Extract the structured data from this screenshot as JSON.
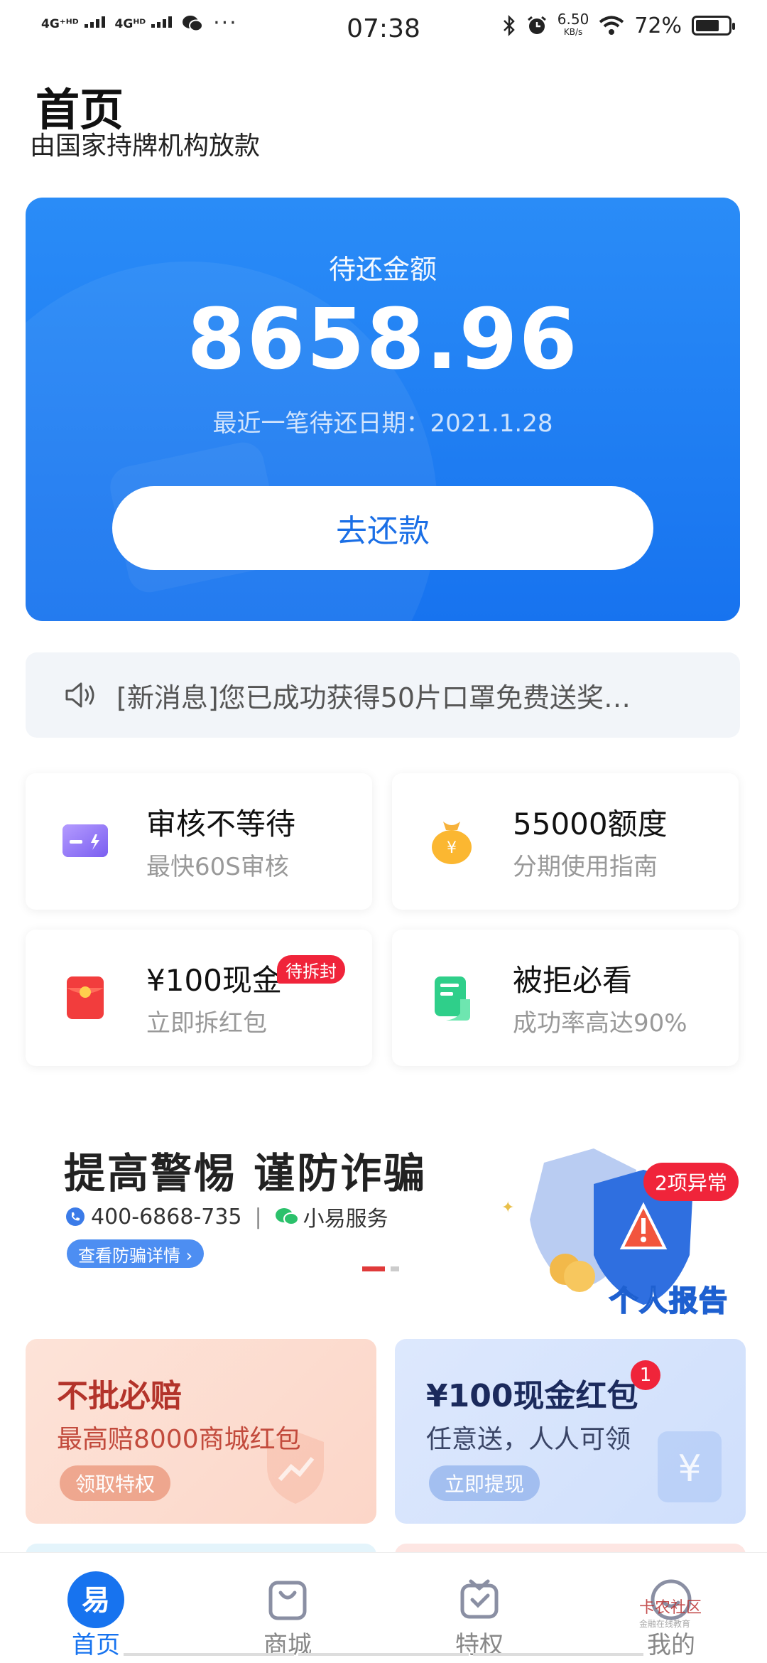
{
  "status_bar": {
    "net1": "4G⁺ᴴᴰ",
    "net2": "4Gᴴᴰ",
    "dots": "···",
    "time": "07:38",
    "speed_value": "6.50",
    "speed_unit": "KB/s",
    "battery": "72%"
  },
  "header": {
    "title": "首页",
    "subtitle": "由国家持牌机构放款"
  },
  "repay_card": {
    "label": "待还金额",
    "amount": "8658.96",
    "date": "最近一笔待还日期：2021.1.28",
    "button": "去还款",
    "colors": {
      "start": "#2a8cf7",
      "end": "#1773ef"
    }
  },
  "notice": {
    "text": "[新消息]您已成功获得50片口罩免费送奖…",
    "icon": "speaker-icon"
  },
  "features": [
    {
      "title": "审核不等待",
      "subtitle": "最快60S审核",
      "icon": "card-icon"
    },
    {
      "title": "55000额度",
      "subtitle": "分期使用指南",
      "icon": "money-bag-icon"
    },
    {
      "title": "¥100现金",
      "subtitle": "立即拆红包",
      "badge": "待拆封",
      "icon": "red-packet-icon"
    },
    {
      "title": "被拒必看",
      "subtitle": "成功率高达90%",
      "icon": "document-icon"
    }
  ],
  "banner": {
    "title": "提高警惕 谨防诈骗",
    "phone": "400-6868-735",
    "separator": "|",
    "wechat": "小易服务",
    "link": "查看防骗详情 ›",
    "shield_badge": "2项异常",
    "report": "个人报告"
  },
  "promos": [
    {
      "title": "不批必赔",
      "subtitle": "最高赔8000商城红包",
      "button": "领取特权"
    },
    {
      "title": "¥100现金红包",
      "subtitle": "任意送，人人可领",
      "button": "立即提现",
      "count": "1"
    }
  ],
  "tabs": [
    {
      "label": "首页",
      "icon": "home-logo-icon",
      "active": true
    },
    {
      "label": "商城",
      "icon": "shopping-bag-icon",
      "active": false
    },
    {
      "label": "特权",
      "icon": "privilege-icon",
      "active": false
    },
    {
      "label": "我的",
      "icon": "profile-icon",
      "active": false
    }
  ],
  "watermark": {
    "text": "卡农社区",
    "sub": "金融在线教育"
  },
  "colors": {
    "primary": "#1773ef",
    "badge_red": "#f0243a"
  }
}
